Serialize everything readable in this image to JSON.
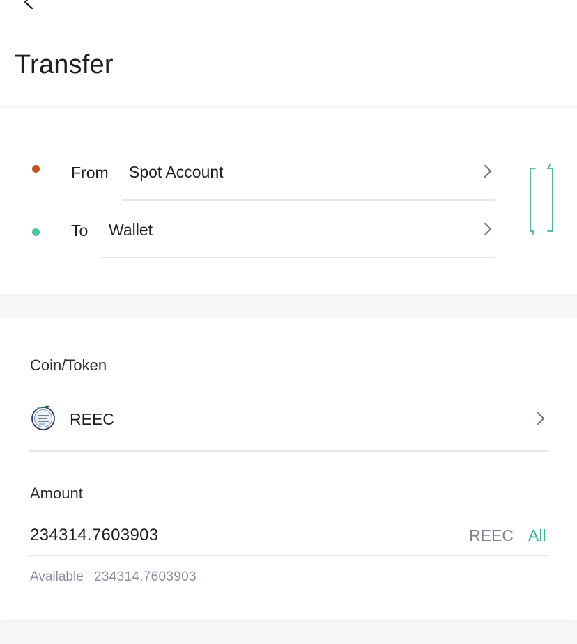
{
  "header": {
    "title": "Transfer",
    "back_icon": "chevron-left-icon"
  },
  "transfer": {
    "from_label": "From",
    "from_value": "Spot Account",
    "to_label": "To",
    "to_value": "Wallet",
    "from_dot_color": "#c2541e",
    "to_dot_color": "#4fc6a2",
    "swap_icon": "swap-vertical-icon"
  },
  "coin": {
    "section_label": "Coin/Token",
    "name": "REEC",
    "logo_icon": "reec-coin-logo"
  },
  "amount": {
    "section_label": "Amount",
    "value": "234314.7603903",
    "unit": "REEC",
    "all_label": "All",
    "available_label": "Available",
    "available_value": "234314.7603903"
  },
  "colors": {
    "accent": "#3fb68b",
    "muted": "#8a8da0"
  }
}
